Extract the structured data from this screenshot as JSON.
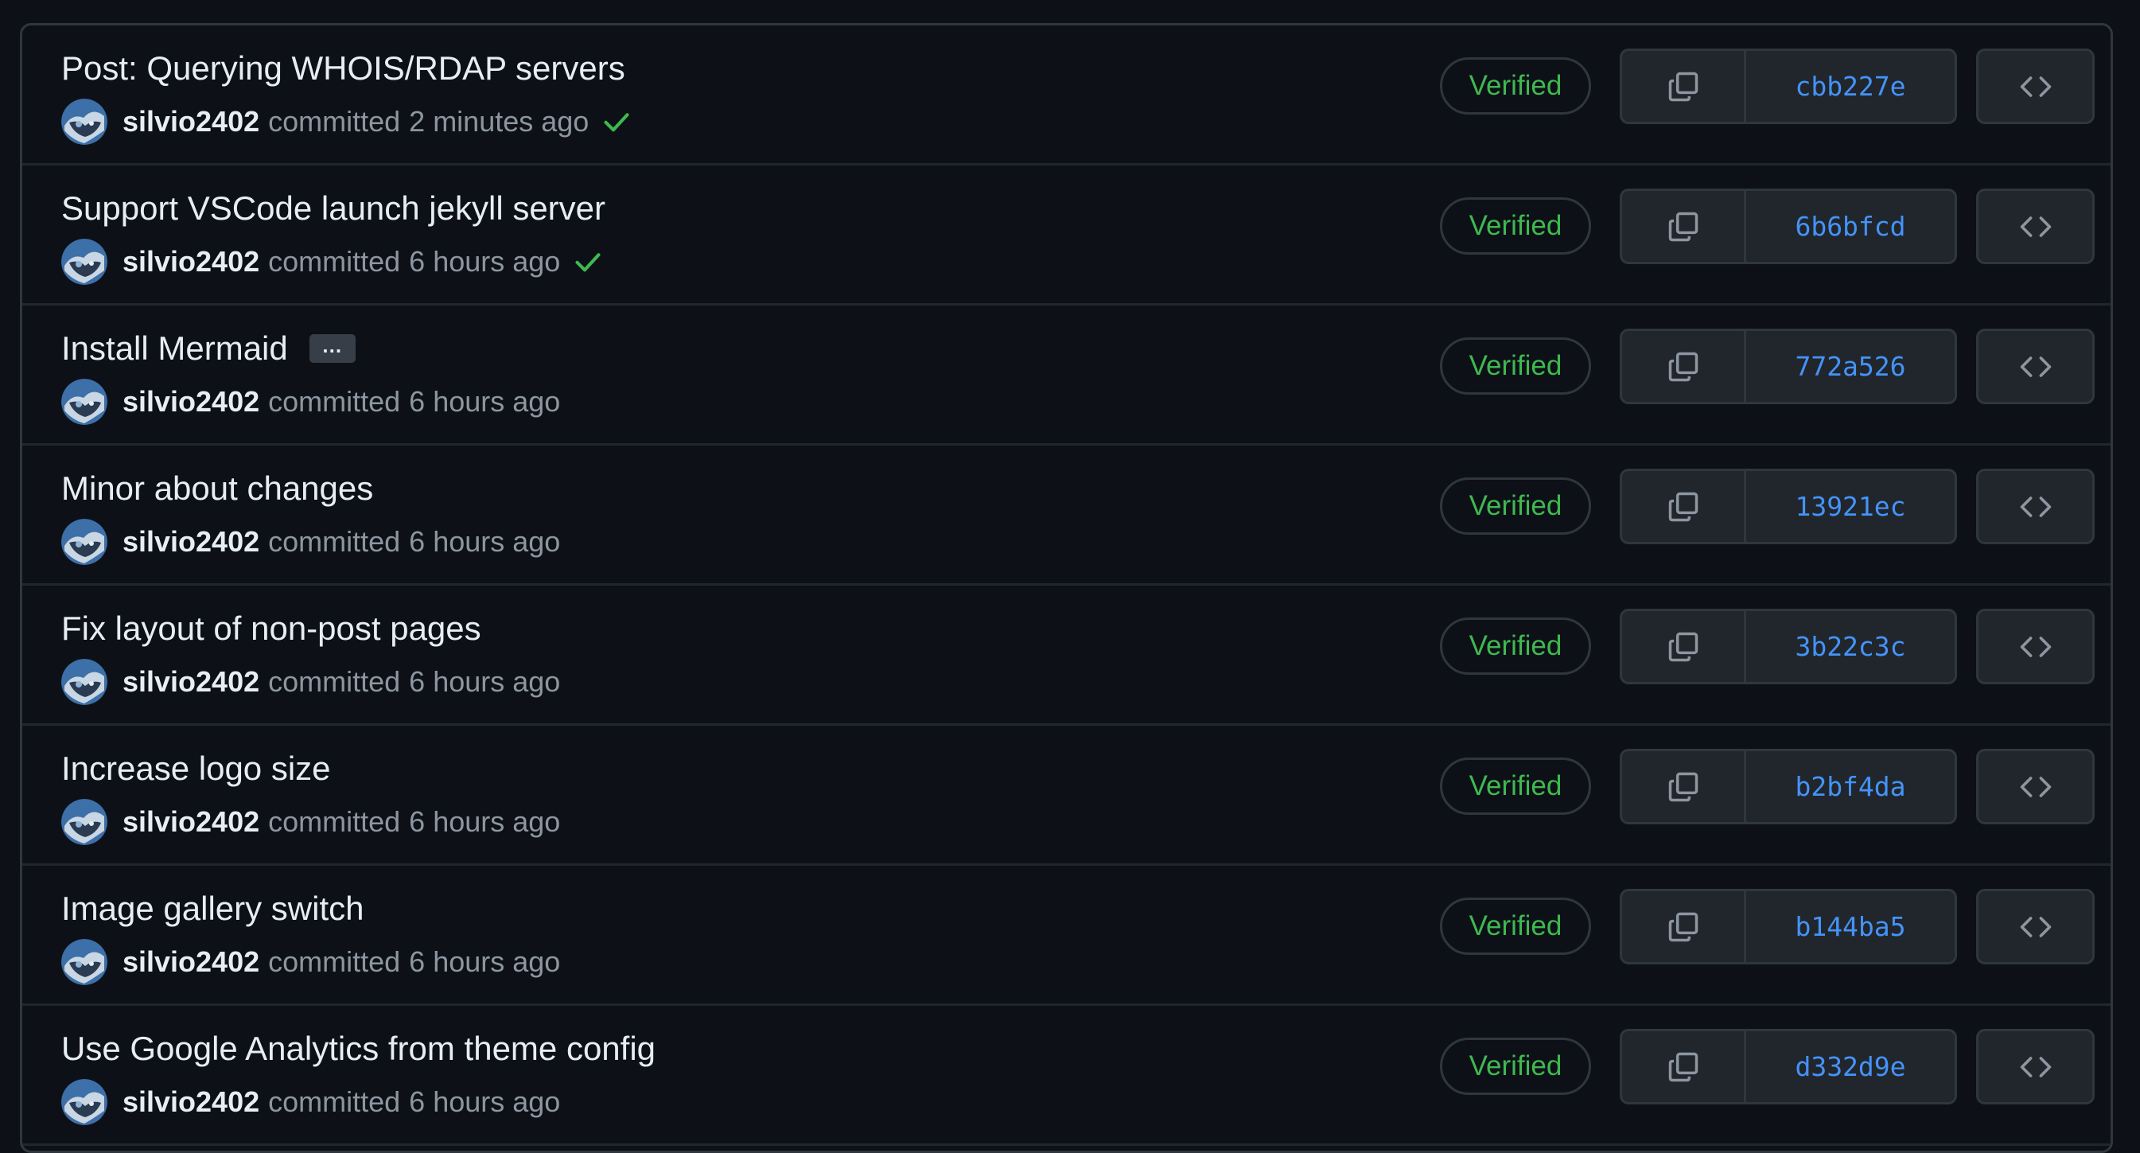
{
  "colors": {
    "background": "#0d1117",
    "border": "#30363d",
    "button_bg": "#21262d",
    "verified_green": "#3fb950",
    "sha_blue": "#4493f8",
    "muted_text": "#8d96a0"
  },
  "commits": [
    {
      "title": "Post: Querying WHOIS/RDAP servers",
      "author": "silvio2402",
      "action": "committed",
      "time": "2 minutes ago",
      "status_check": true,
      "ellipsis": "",
      "verified": "Verified",
      "sha": "cbb227e"
    },
    {
      "title": "Support VSCode launch jekyll server",
      "author": "silvio2402",
      "action": "committed",
      "time": "6 hours ago",
      "status_check": true,
      "ellipsis": "",
      "verified": "Verified",
      "sha": "6b6bfcd"
    },
    {
      "title": "Install Mermaid",
      "author": "silvio2402",
      "action": "committed",
      "time": "6 hours ago",
      "status_check": false,
      "ellipsis": "…",
      "verified": "Verified",
      "sha": "772a526"
    },
    {
      "title": "Minor about changes",
      "author": "silvio2402",
      "action": "committed",
      "time": "6 hours ago",
      "status_check": false,
      "ellipsis": "",
      "verified": "Verified",
      "sha": "13921ec"
    },
    {
      "title": "Fix layout of non-post pages",
      "author": "silvio2402",
      "action": "committed",
      "time": "6 hours ago",
      "status_check": false,
      "ellipsis": "",
      "verified": "Verified",
      "sha": "3b22c3c"
    },
    {
      "title": "Increase logo size",
      "author": "silvio2402",
      "action": "committed",
      "time": "6 hours ago",
      "status_check": false,
      "ellipsis": "",
      "verified": "Verified",
      "sha": "b2bf4da"
    },
    {
      "title": "Image gallery switch",
      "author": "silvio2402",
      "action": "committed",
      "time": "6 hours ago",
      "status_check": false,
      "ellipsis": "",
      "verified": "Verified",
      "sha": "b144ba5"
    },
    {
      "title": "Use Google Analytics from theme config",
      "author": "silvio2402",
      "action": "committed",
      "time": "6 hours ago",
      "status_check": false,
      "ellipsis": "",
      "verified": "Verified",
      "sha": "d332d9e"
    }
  ]
}
